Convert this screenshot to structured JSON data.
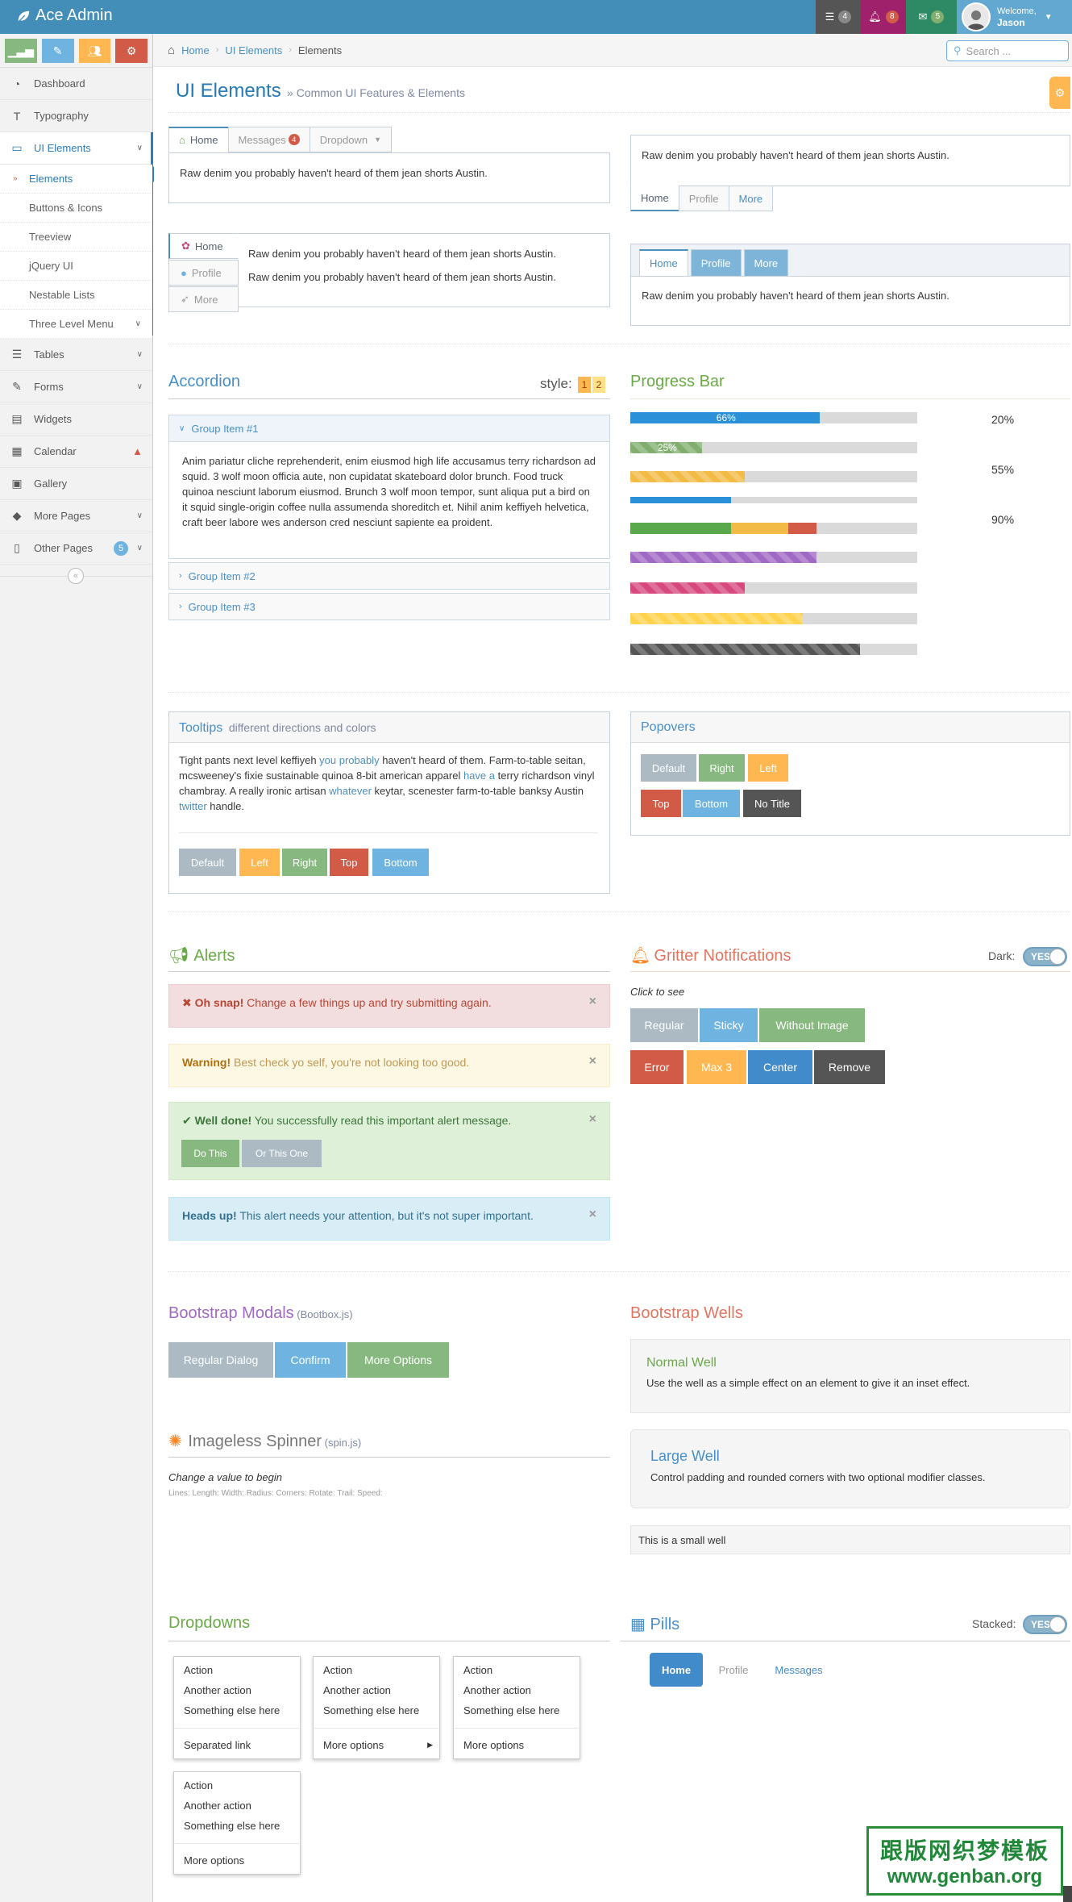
{
  "navbar": {
    "brand": "Ace Admin",
    "tasks_count": "4",
    "notifications_count": "8",
    "messages_count": "5",
    "welcome": "Welcome,",
    "user": "Jason"
  },
  "sidebar": {
    "items": [
      {
        "label": "Dashboard",
        "icon": "tachometer-icon"
      },
      {
        "label": "Typography",
        "icon": "text-height-icon"
      },
      {
        "label": "UI Elements",
        "icon": "desktop-icon"
      },
      {
        "label": "Tables",
        "icon": "list-icon"
      },
      {
        "label": "Forms",
        "icon": "pencil-square-icon"
      },
      {
        "label": "Widgets",
        "icon": "list-alt-icon"
      },
      {
        "label": "Calendar",
        "icon": "calendar-icon"
      },
      {
        "label": "Gallery",
        "icon": "picture-icon"
      },
      {
        "label": "More Pages",
        "icon": "tag-icon"
      },
      {
        "label": "Other Pages",
        "icon": "file-icon",
        "badge": "5"
      }
    ],
    "sub_items": [
      "Elements",
      "Buttons & Icons",
      "Treeview",
      "jQuery UI",
      "Nestable Lists",
      "Three Level Menu"
    ]
  },
  "breadcrumb": {
    "home": "Home",
    "ui": "UI Elements",
    "current": "Elements"
  },
  "search": {
    "placeholder": "Search ..."
  },
  "page": {
    "title": "UI Elements",
    "subtitle": "Common UI Features & Elements"
  },
  "tabs": {
    "text": "Raw denim you probably haven't heard of them jean shorts Austin.",
    "top": [
      "Home",
      "Messages",
      "Dropdown"
    ],
    "messages_badge": "4",
    "bottom": [
      "Home",
      "Profile",
      "More"
    ],
    "left": [
      "Home",
      "Profile",
      "More"
    ],
    "colored": [
      "Home",
      "Profile",
      "More"
    ]
  },
  "accordion": {
    "title": "Accordion",
    "style_label": "style:",
    "styles": [
      "1",
      "2"
    ],
    "groups": [
      "Group Item #1",
      "Group Item #2",
      "Group Item #3"
    ],
    "body": "Anim pariatur cliche reprehenderit, enim eiusmod high life accusamus terry richardson ad squid. 3 wolf moon officia aute, non cupidatat skateboard dolor brunch. Food truck quinoa nesciunt laborum eiusmod. Brunch 3 wolf moon tempor, sunt aliqua put a bird on it squid single-origin coffee nulla assumenda shoreditch et. Nihil anim keffiyeh helvetica, craft beer labore wes anderson cred nesciunt sapiente ea proident."
  },
  "progress": {
    "title": "Progress Bar",
    "bars": [
      {
        "label": "66%",
        "value": 66
      },
      {
        "label": "25%",
        "value": 25
      },
      {
        "value": 40
      },
      {
        "value": 35
      },
      {
        "segments": [
          35,
          20,
          10
        ]
      },
      {
        "value": 65
      },
      {
        "value": 40
      },
      {
        "value": 60
      },
      {
        "value": 80
      }
    ],
    "easy_pie": [
      "20%",
      "55%",
      "90%"
    ]
  },
  "tooltips": {
    "title": "Tooltips",
    "subtitle": "different directions and colors",
    "text_1": "Tight pants next level keffiyeh ",
    "link_1": "you probably",
    "text_2": " haven't heard of them. Farm-to-table seitan, mcsweeney's fixie sustainable quinoa 8-bit american apparel ",
    "link_2": "have a",
    "text_3": " terry richardson vinyl chambray. A really ironic artisan ",
    "link_3": "whatever",
    "text_4": " keytar, scenester farm-to-table banksy Austin ",
    "link_4": "twitter",
    "text_5": " handle.",
    "buttons": [
      "Default",
      "Left",
      "Right",
      "Top",
      "Bottom"
    ]
  },
  "popovers": {
    "title": "Popovers",
    "buttons": [
      "Default",
      "Right",
      "Left",
      "Top",
      "Bottom",
      "No Title"
    ]
  },
  "alerts": {
    "title": "Alerts",
    "danger_strong": "Oh snap!",
    "danger_text": " Change a few things up and try submitting again.",
    "warning_strong": "Warning!",
    "warning_text": " Best check yo self, you're not looking too good.",
    "success_strong": "Well done!",
    "success_text": " You successfully read this important alert message.",
    "success_btn_1": "Do This",
    "success_btn_2": "Or This One",
    "info_strong": "Heads up!",
    "info_text": " This alert needs your attention, but it's not super important.",
    "close": "×"
  },
  "gritter": {
    "title": "Gritter Notifications",
    "dark_label": "Dark:",
    "toggle": "YES",
    "click_to_see": "Click to see",
    "buttons": [
      "Regular",
      "Sticky",
      "Without Image",
      "Error",
      "Max 3",
      "Center",
      "Remove"
    ]
  },
  "modals": {
    "title": "Bootstrap Modals",
    "subtitle": "(Bootbox.js)",
    "buttons": [
      "Regular Dialog",
      "Confirm",
      "More Options"
    ]
  },
  "spinner": {
    "title": "Imageless Spinner",
    "subtitle": "(spin.js)",
    "hint": "Change a value to begin",
    "fields": "Lines: Length: Width: Radius: Corners: Rotate: Trail: Speed:"
  },
  "wells": {
    "title": "Bootstrap Wells",
    "normal_title": "Normal Well",
    "normal_text": "Use the well as a simple effect on an element to give it an inset effect.",
    "large_title": "Large Well",
    "large_text": "Control padding and rounded corners with two optional modifier classes.",
    "small_text": "This is a small well"
  },
  "dropdowns": {
    "title": "Dropdowns",
    "menus": [
      {
        "items": [
          "Action",
          "Another action",
          "Something else here"
        ],
        "footer": "Separated link"
      },
      {
        "items": [
          "Action",
          "Another action",
          "Something else here"
        ],
        "footer": "More options"
      },
      {
        "items": [
          "Action",
          "Another action",
          "Something else here"
        ],
        "footer": "More options"
      },
      {
        "items": [
          "Action",
          "Another action",
          "Something else here"
        ],
        "footer": "More options"
      }
    ]
  },
  "pills": {
    "title": "Pills",
    "stacked_label": "Stacked:",
    "toggle": "YES",
    "items": [
      "Home",
      "Profile",
      "Messages"
    ]
  },
  "watermark": {
    "line1": "跟版网织梦模板",
    "line2": "www.genban.org"
  },
  "colors": {
    "primary": "#438eb9",
    "blue": "#6fb3e0",
    "green": "#87b87f",
    "orange": "#ffb752",
    "red": "#d15b47",
    "grey": "#abbac3",
    "inverse": "#555555"
  }
}
